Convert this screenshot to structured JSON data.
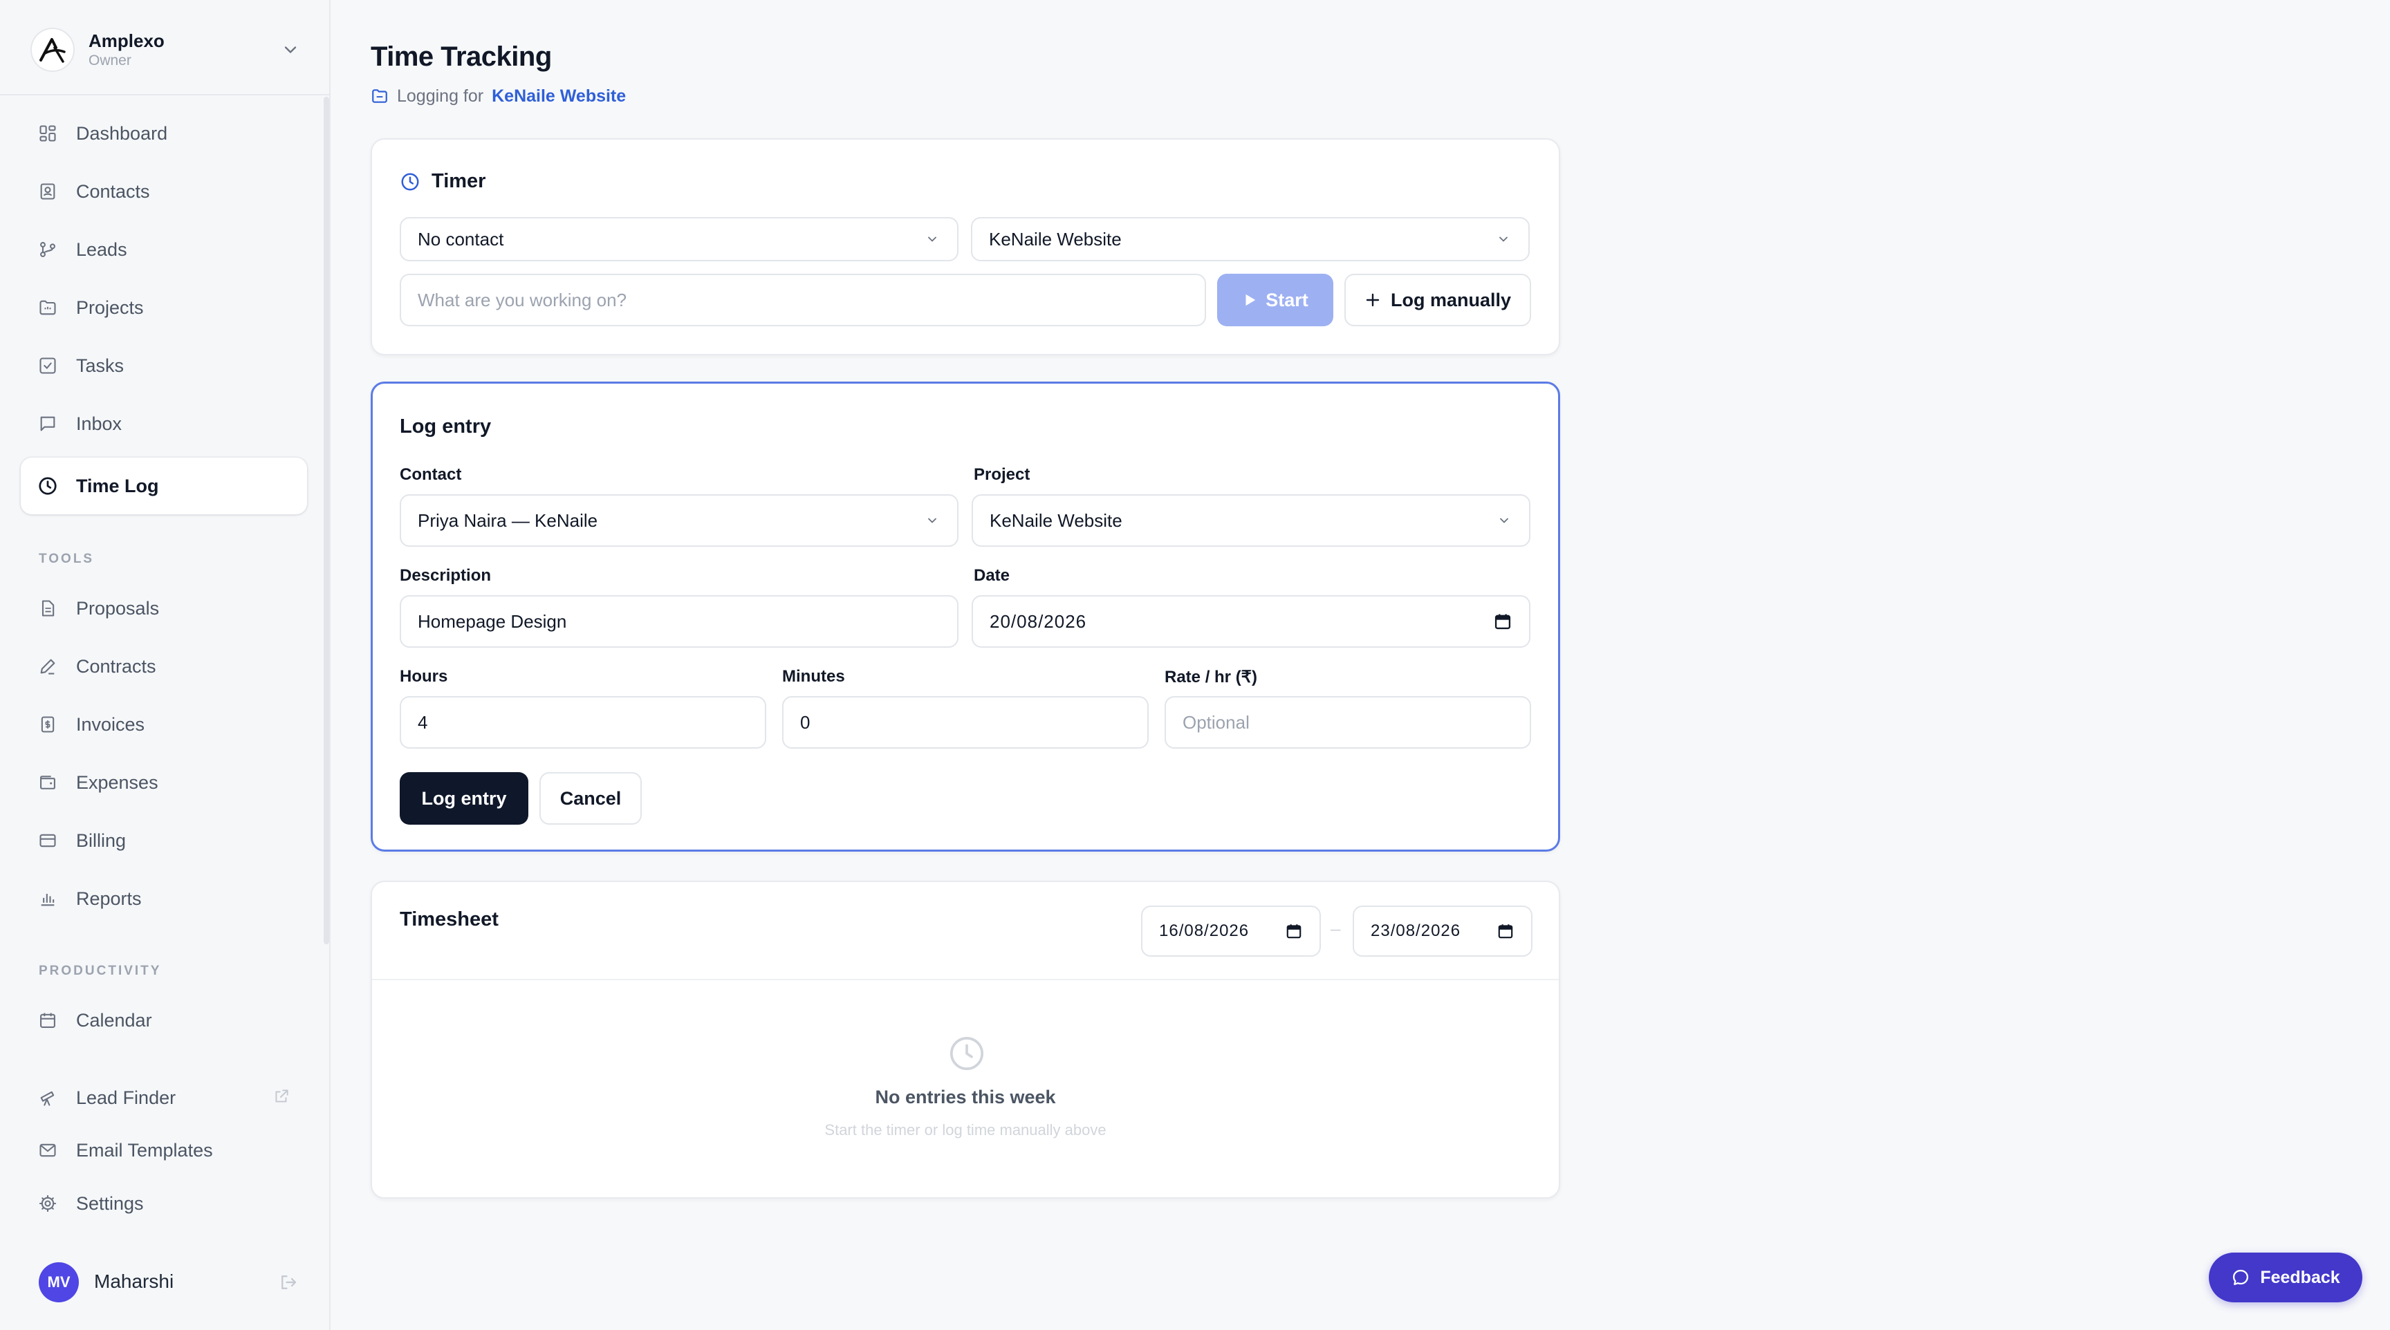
{
  "workspace": {
    "name": "Amplexo",
    "role": "Owner"
  },
  "sidebar": {
    "items": [
      {
        "label": "Dashboard"
      },
      {
        "label": "Contacts"
      },
      {
        "label": "Leads"
      },
      {
        "label": "Projects"
      },
      {
        "label": "Tasks"
      },
      {
        "label": "Inbox"
      },
      {
        "label": "Time Log"
      }
    ],
    "tools_heading": "TOOLS",
    "tools": [
      {
        "label": "Proposals"
      },
      {
        "label": "Contracts"
      },
      {
        "label": "Invoices"
      },
      {
        "label": "Expenses"
      },
      {
        "label": "Billing"
      },
      {
        "label": "Reports"
      }
    ],
    "productivity_heading": "PRODUCTIVITY",
    "productivity": [
      {
        "label": "Calendar"
      }
    ],
    "extras": [
      {
        "label": "Lead Finder"
      },
      {
        "label": "Email Templates"
      },
      {
        "label": "Settings"
      }
    ],
    "user": {
      "initials": "MV",
      "name": "Maharshi"
    }
  },
  "page": {
    "title": "Time Tracking",
    "logging_prefix": "Logging for",
    "logging_project": "KeNaile Website"
  },
  "timer": {
    "title": "Timer",
    "contact_value": "No contact",
    "project_value": "KeNaile Website",
    "task_placeholder": "What are you working on?",
    "start_label": "Start",
    "log_manually_label": "Log manually"
  },
  "log_entry": {
    "title": "Log entry",
    "contact_label": "Contact",
    "contact_value": "Priya Naira — KeNaile",
    "project_label": "Project",
    "project_value": "KeNaile Website",
    "description_label": "Description",
    "description_value": "Homepage Design",
    "date_label": "Date",
    "date_value": "20/08/2026",
    "hours_label": "Hours",
    "hours_value": "4",
    "minutes_label": "Minutes",
    "minutes_value": "0",
    "rate_label": "Rate / hr (₹)",
    "rate_placeholder": "Optional",
    "submit_label": "Log entry",
    "cancel_label": "Cancel"
  },
  "timesheet": {
    "title": "Timesheet",
    "start_date": "16/08/2026",
    "separator": "–",
    "end_date": "23/08/2026",
    "empty_title": "No entries this week",
    "empty_subtitle": "Start the timer or log time manually above"
  },
  "feedback_label": "Feedback",
  "colors": {
    "accent": "#2f5fd8",
    "start_button": "#9db0f2",
    "dark_button": "#0f172a",
    "feedback": "#4338ca",
    "active_border": "#5b7be6"
  }
}
